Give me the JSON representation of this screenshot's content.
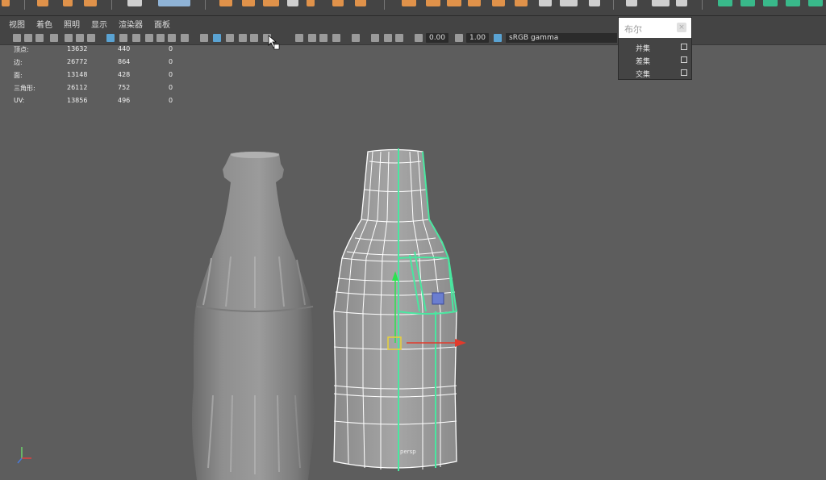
{
  "panel_menu": [
    "视图",
    "着色",
    "照明",
    "显示",
    "渲染器",
    "面板"
  ],
  "toolbar_fields": {
    "exposure": "0.00",
    "gamma": "1.00",
    "color_space": "sRGB gamma"
  },
  "hud": {
    "rows": [
      {
        "label": "顶点:",
        "v1": "13632",
        "v2": "440",
        "v3": "0"
      },
      {
        "label": "边:",
        "v1": "26772",
        "v2": "864",
        "v3": "0"
      },
      {
        "label": "面:",
        "v1": "13148",
        "v2": "428",
        "v3": "0"
      },
      {
        "label": "三角形:",
        "v1": "26112",
        "v2": "752",
        "v3": "0"
      },
      {
        "label": "UV:",
        "v1": "13856",
        "v2": "496",
        "v3": "0"
      }
    ]
  },
  "boolean_popup": {
    "title": "布尔",
    "close_glyph": "×",
    "options": [
      {
        "label": "并集",
        "checked": false
      },
      {
        "label": "差集",
        "checked": false
      },
      {
        "label": "交集",
        "checked": false
      }
    ]
  },
  "camera_label": "persp",
  "colors": {
    "accent_orange": "#e0924a",
    "selection_green": "#49e7a0",
    "toolbar_blue": "#5aa3d3"
  }
}
